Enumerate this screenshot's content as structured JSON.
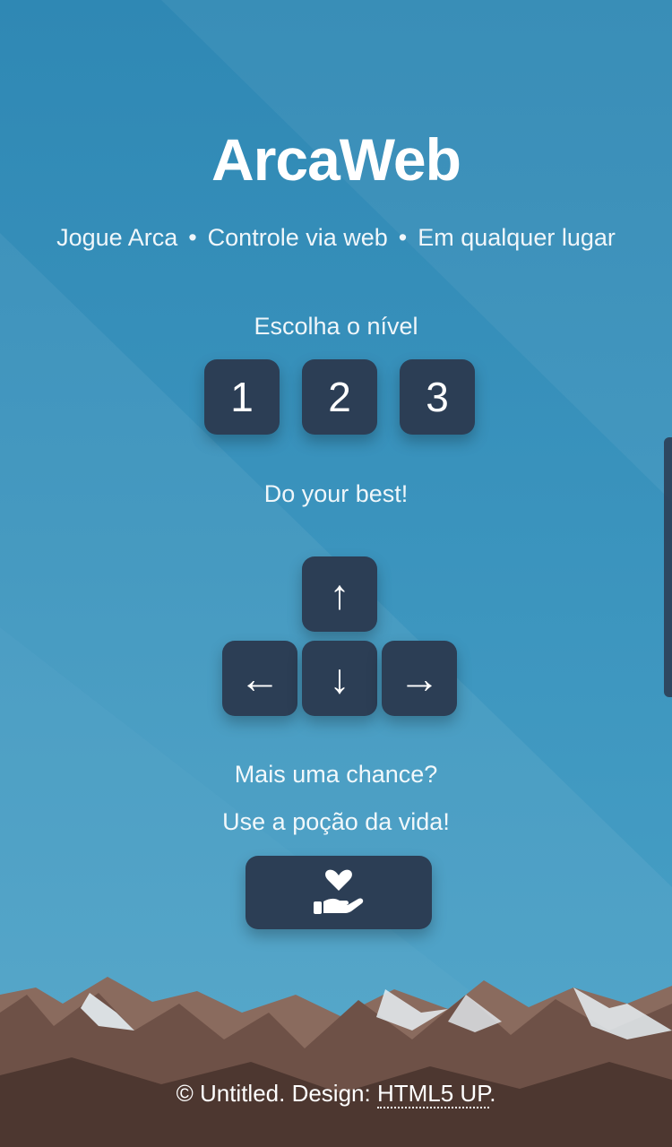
{
  "header": {
    "title": "ArcaWeb",
    "tagline": [
      "Jogue Arca",
      "Controle via web",
      "Em qualquer lugar"
    ],
    "separator": "•"
  },
  "level": {
    "prompt": "Escolha o nível",
    "buttons": [
      "1",
      "2",
      "3"
    ]
  },
  "motto": "Do your best!",
  "dpad": {
    "up": "↑",
    "left": "←",
    "down": "↓",
    "right": "→"
  },
  "potion": {
    "question": "Mais uma chance?",
    "hint": "Use a poção da vida!",
    "icon": "hand-holding-heart-icon"
  },
  "footer": {
    "prefix": "© Untitled. Design: ",
    "link_label": "HTML5 UP",
    "suffix": "."
  },
  "colors": {
    "background": "#3a93bd",
    "button": "#2c3e55",
    "text": "#ffffff"
  }
}
